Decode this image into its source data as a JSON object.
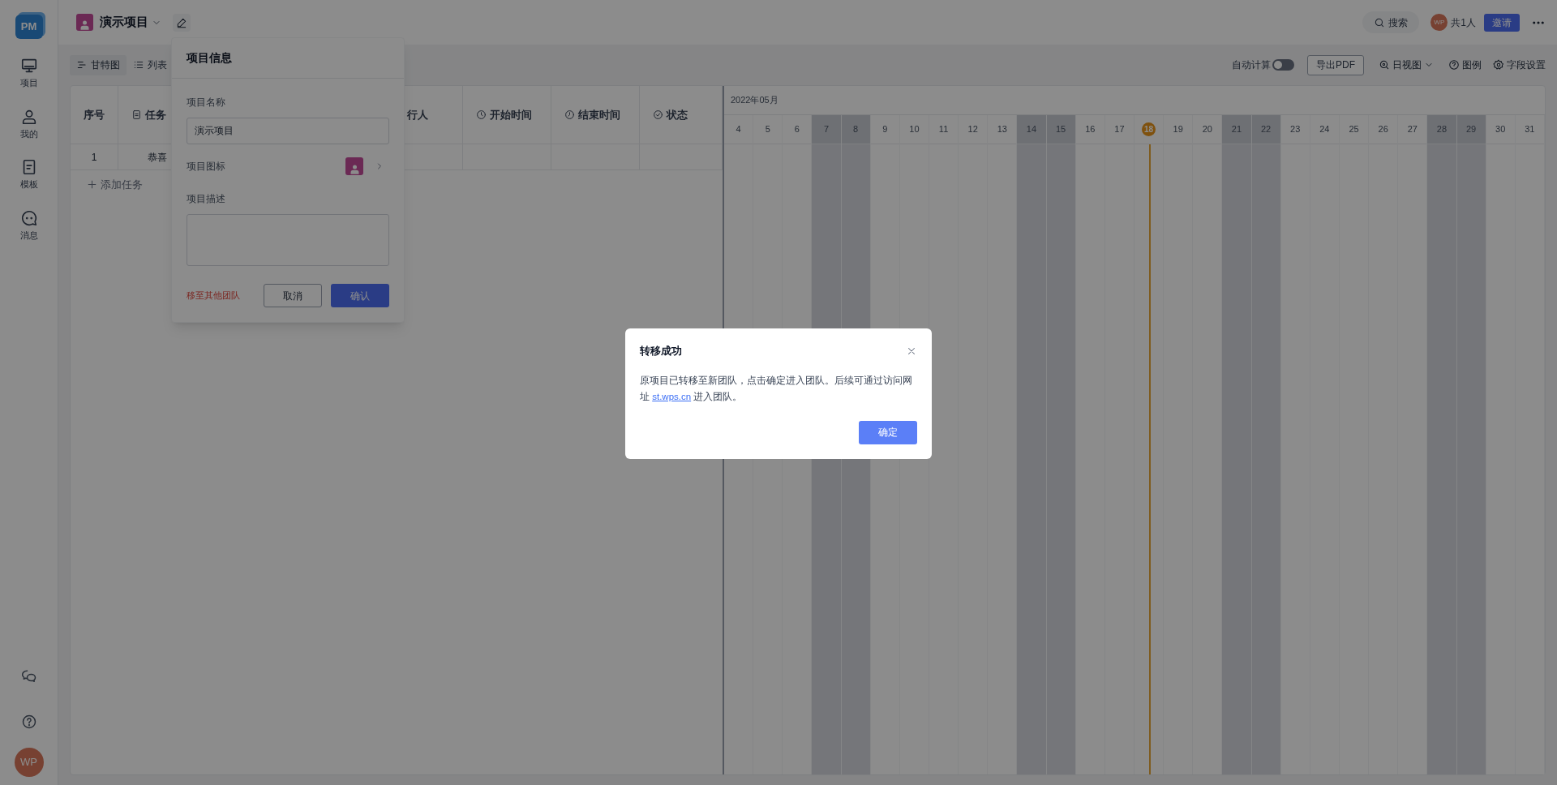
{
  "sidebar": {
    "logo": "PM",
    "items": [
      {
        "label": "项目"
      },
      {
        "label": "我的"
      },
      {
        "label": "模板"
      },
      {
        "label": "消息"
      }
    ],
    "avatar": "WP"
  },
  "header": {
    "project_title": "演示项目",
    "search": "搜索",
    "avatar": "WP",
    "member_count": "共1人",
    "invite": "邀请"
  },
  "view_tabs": [
    {
      "label": "甘特图",
      "selected": true
    },
    {
      "label": "列表",
      "selected": false
    }
  ],
  "toolbar": {
    "auto_calc": {
      "label": "自动计算",
      "on": false
    },
    "export": "导出PDF",
    "view_mode": "日视图",
    "legend": "图例",
    "field_settings": "字段设置"
  },
  "table": {
    "columns": [
      "序号",
      "任务",
      "行人",
      "开始时间",
      "结束时间",
      "状态"
    ],
    "rows": [
      [
        "1",
        "恭喜"
      ]
    ],
    "add_task": "添加任务"
  },
  "gantt": {
    "month": "2022年05月",
    "days": [
      {
        "label": "4",
        "weekend": false,
        "today": false
      },
      {
        "label": "5",
        "weekend": false,
        "today": false
      },
      {
        "label": "6",
        "weekend": false,
        "today": false
      },
      {
        "label": "7",
        "weekend": true,
        "today": false
      },
      {
        "label": "8",
        "weekend": true,
        "today": false
      },
      {
        "label": "9",
        "weekend": false,
        "today": false
      },
      {
        "label": "10",
        "weekend": false,
        "today": false
      },
      {
        "label": "11",
        "weekend": false,
        "today": false
      },
      {
        "label": "12",
        "weekend": false,
        "today": false
      },
      {
        "label": "13",
        "weekend": false,
        "today": false
      },
      {
        "label": "14",
        "weekend": true,
        "today": false
      },
      {
        "label": "15",
        "weekend": true,
        "today": false
      },
      {
        "label": "16",
        "weekend": false,
        "today": false
      },
      {
        "label": "17",
        "weekend": false,
        "today": false
      },
      {
        "label": "18",
        "weekend": false,
        "today": true
      },
      {
        "label": "19",
        "weekend": false,
        "today": false
      },
      {
        "label": "20",
        "weekend": false,
        "today": false
      },
      {
        "label": "21",
        "weekend": true,
        "today": false
      },
      {
        "label": "22",
        "weekend": true,
        "today": false
      },
      {
        "label": "23",
        "weekend": false,
        "today": false
      },
      {
        "label": "24",
        "weekend": false,
        "today": false
      },
      {
        "label": "25",
        "weekend": false,
        "today": false
      },
      {
        "label": "26",
        "weekend": false,
        "today": false
      },
      {
        "label": "27",
        "weekend": false,
        "today": false
      },
      {
        "label": "28",
        "weekend": true,
        "today": false
      },
      {
        "label": "29",
        "weekend": true,
        "today": false
      },
      {
        "label": "30",
        "weekend": false,
        "today": false
      },
      {
        "label": "31",
        "weekend": false,
        "today": false
      }
    ]
  },
  "project_info_popup": {
    "title": "项目信息",
    "name_label": "项目名称",
    "name_value": "演示项目",
    "icon_label": "项目图标",
    "description_label": "项目描述",
    "move_link": "移至其他团队",
    "cancel": "取消",
    "confirm": "确认"
  },
  "dialog": {
    "title": "转移成功",
    "text_before": "原项目已转移至新团队，点击确定进入团队。后续可通过访问网址",
    "link": "st.wps.cn",
    "text_after": "进入团队。",
    "ok": "确定"
  }
}
